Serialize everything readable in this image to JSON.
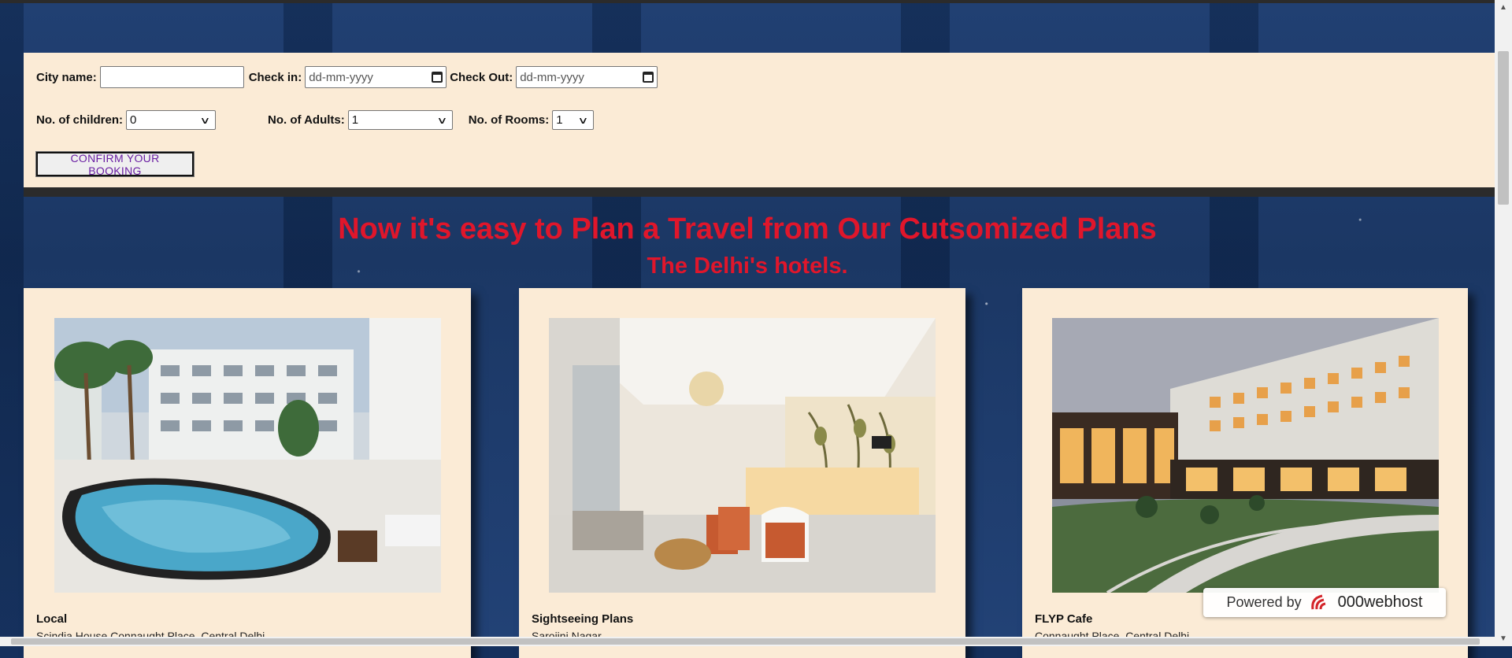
{
  "booking": {
    "city_label": "City name:",
    "city_value": "",
    "checkin_label": "Check in:",
    "checkin_placeholder": "dd-mm-yyyy",
    "checkout_label": "Check Out:",
    "checkout_placeholder": "dd-mm-yyyy",
    "children_label": "No. of children:",
    "children_value": "0",
    "adults_label": "No. of Adults:",
    "adults_value": "1",
    "rooms_label": "No. of Rooms:",
    "rooms_value": "1",
    "confirm_label": "CONFIRM YOUR BOOKING"
  },
  "main": {
    "headline": "Now it's easy to Plan a Travel from Our Cutsomized Plans",
    "subheadline": "The Delhi's hotels."
  },
  "cards": [
    {
      "title": "Local",
      "subtitle": "Scindia House Connaught Place, Central Delhi",
      "image": "hotel-pool-photo"
    },
    {
      "title": "Sightseeing Plans",
      "subtitle": "Sarojini Nagar",
      "image": "hotel-lobby-photo"
    },
    {
      "title": "FLYP Cafe",
      "subtitle": "Connaught Place, Central Delhi",
      "image": "hotel-building-photo"
    }
  ],
  "badge": {
    "powered_by": "Powered by",
    "brand": "000webhost",
    "icon": "000webhost-logo-icon"
  }
}
